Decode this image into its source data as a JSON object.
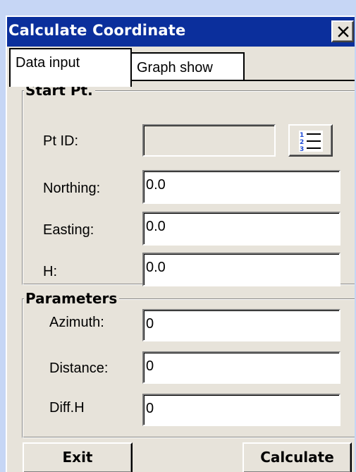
{
  "window": {
    "title": "Calculate Coordinate",
    "close_icon": "close-icon"
  },
  "tabs": [
    {
      "label": "Data input",
      "active": true
    },
    {
      "label": "Graph show",
      "active": false
    }
  ],
  "start_pt": {
    "title": "Start Pt.",
    "pt_id": {
      "label": "Pt ID:",
      "value": "",
      "disabled": true,
      "button_icon": "numbered-list-icon"
    },
    "northing": {
      "label": "Northing:",
      "value": "0.0"
    },
    "easting": {
      "label": "Easting:",
      "value": "0.0"
    },
    "h": {
      "label": "H:",
      "value": "0.0"
    }
  },
  "parameters": {
    "title": "Parameters",
    "azimuth": {
      "label": "Azimuth:",
      "value": "0"
    },
    "distance": {
      "label": "Distance:",
      "value": "0"
    },
    "diff_h": {
      "label": "Diff.H",
      "value": "0"
    }
  },
  "buttons": {
    "exit": "Exit",
    "calculate": "Calculate"
  },
  "colors": {
    "background": "#c6d6f5",
    "titlebar": "#0b2f9c",
    "dialog": "#e7e3da",
    "list_icon_blue": "#1f4bd6"
  }
}
